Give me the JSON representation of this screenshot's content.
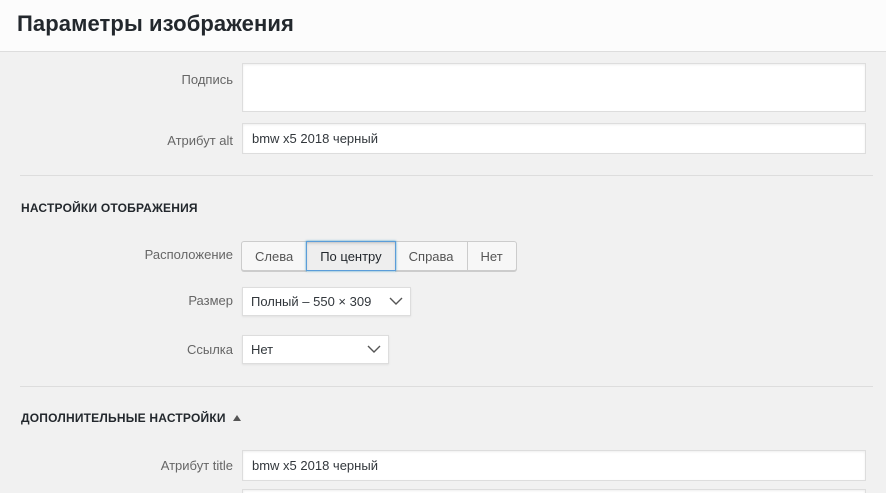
{
  "modal": {
    "title": "Параметры изображения"
  },
  "fields": {
    "caption_label": "Подпись",
    "caption_value": "",
    "alt_label": "Атрибут alt",
    "alt_value": "bmw x5 2018 черный"
  },
  "display_settings": {
    "heading": "НАСТРОЙКИ ОТОБРАЖЕНИЯ",
    "align_label": "Расположение",
    "align_options": [
      "Слева",
      "По центру",
      "Справа",
      "Нет"
    ],
    "align_selected": "По центру",
    "size_label": "Размер",
    "size_value": "Полный – 550 × 309",
    "link_label": "Ссылка",
    "link_value": "Нет"
  },
  "advanced_settings": {
    "heading": "ДОПОЛНИТЕЛЬНЫЕ НАСТРОЙКИ",
    "title_label": "Атрибут title",
    "title_value": "bmw x5 2018 черный"
  },
  "colors": {
    "active_border": "#5b9dd9",
    "background": "#f1f1f1"
  }
}
